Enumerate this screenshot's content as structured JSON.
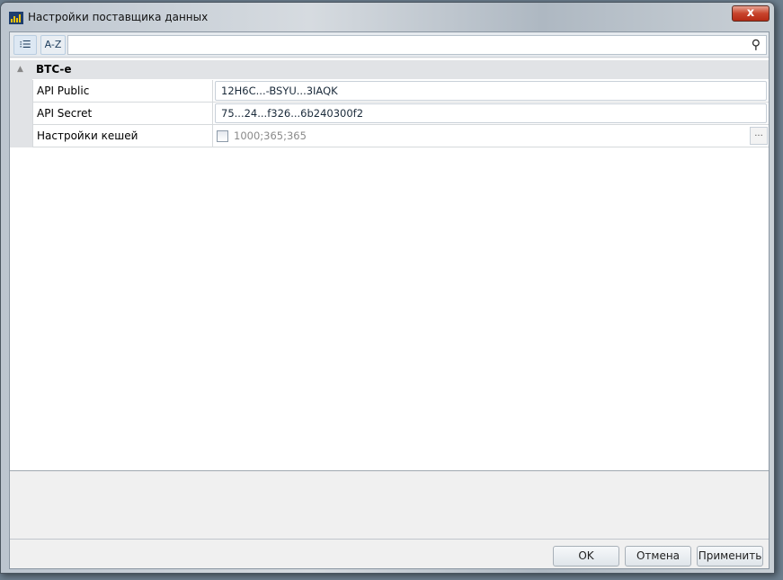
{
  "window": {
    "title": "Настройки поставщика данных",
    "close_label": "x"
  },
  "toolbar": {
    "categorized_icon": "categorized-list-icon",
    "alpha_label": "A-Z",
    "search_placeholder": "",
    "search_icon": "magnifier-icon"
  },
  "grid": {
    "category": "BTC-e",
    "rows": [
      {
        "label": "API Public",
        "value": "12H6C...-BSYU...3IAQK"
      },
      {
        "label": "API Secret",
        "value": "75...24...f326...6b240300f2"
      },
      {
        "label": "Настройки кешей",
        "value": "1000;365;365",
        "checked": false
      }
    ]
  },
  "buttons": {
    "ok": "OK",
    "cancel": "Отмена",
    "apply": "Применить"
  }
}
